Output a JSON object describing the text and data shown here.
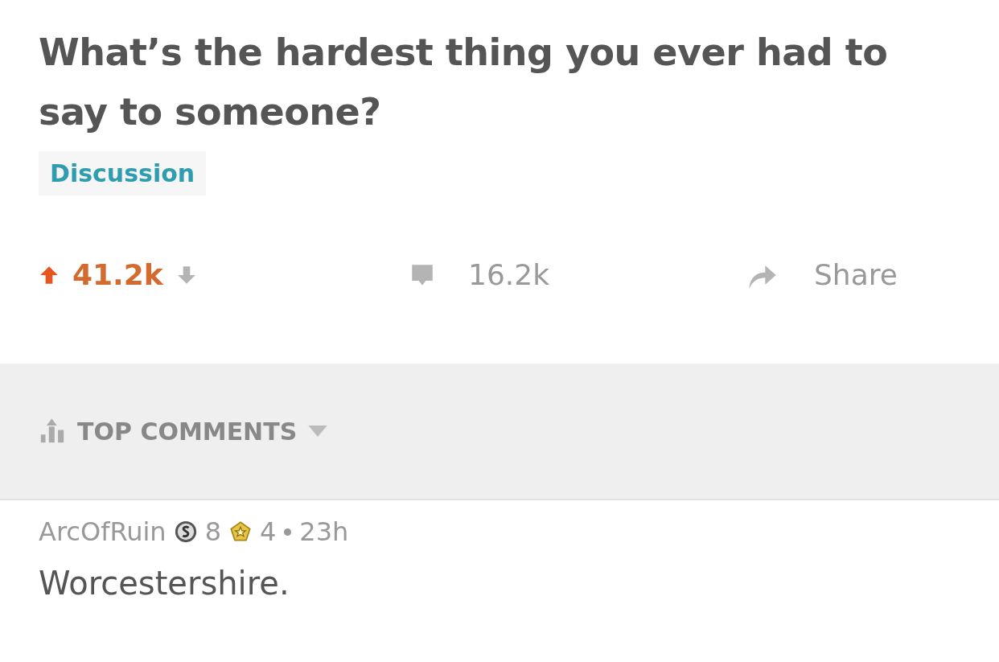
{
  "post": {
    "title": "What’s the hardest thing you ever had to say to someone?",
    "flair": "Discussion",
    "upvoted": true,
    "score": "41.2k",
    "comments": "16.2k",
    "share": "Share"
  },
  "sort": {
    "label": "TOP COMMENTS"
  },
  "comment": {
    "author": "ArcOfRuin",
    "awards": [
      {
        "kind": "silver",
        "count": "8"
      },
      {
        "kind": "gold",
        "count": "4"
      }
    ],
    "age": "23h",
    "body": "Worcestershire."
  }
}
